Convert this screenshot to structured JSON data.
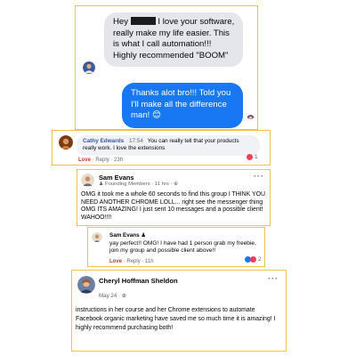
{
  "messenger": {
    "incoming": {
      "greeting": "Hey",
      "text": "I love your software, really make my life easier. This is what I call automation!!! Highly recommended \"BOOM\""
    },
    "outgoing": {
      "text": "Thanks alot bro!!! Told you I'll make all the difference man!",
      "emoji": "😊"
    }
  },
  "comment_cathy": {
    "name": "Cathy Edwards",
    "time": "17:54",
    "text": "You can really tell that your products really work. I love the extensions",
    "like": "Love",
    "reply": "Reply",
    "ago": "23h",
    "reaction_count": "1"
  },
  "post_sam": {
    "name": "Sam Evans",
    "badge": "Founding Members",
    "time": "11 hrs",
    "text": "OMG it took me a whole 60 seconds to find this group I THINK YOU NEED ANOTHER CHROME LOLL... right see the messenger thing OMG ITS AMAZING! I just sent 10 messages and a possible client! WAHOO!!!!"
  },
  "reply_sam": {
    "name": "Sam Evans",
    "text": "yay perfect!! OMG! I have had 1 person grab my freebie, join my group and possible client above!!",
    "like": "Love",
    "reply": "Reply",
    "ago": "11h",
    "reaction_count": "2"
  },
  "post_cheryl": {
    "name": "Cheryl Hoffman Sheldon",
    "date": "May 24",
    "text": "instructions in her course and her Chrome extensions to automate Facebook organic marketing have saved me so much time it is amazing! I highly recommend purchasing both!",
    "more": "···"
  },
  "colors": {
    "card_border": "#f2c14e",
    "messenger_blue": "#1877f2",
    "bubble_gray": "#e4e6eb",
    "love_red": "#f33e58"
  }
}
